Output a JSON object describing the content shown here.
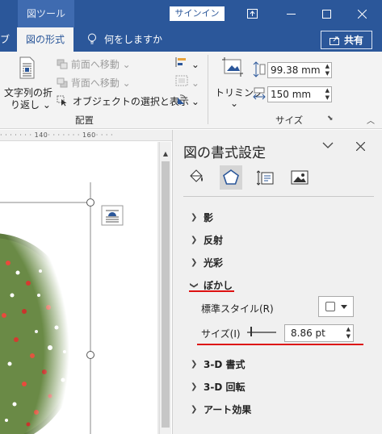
{
  "titlebar": {
    "context_tab": "図ツール",
    "signin": "サインイン"
  },
  "tabs": {
    "prev_fragment": "ブ",
    "active": "図の形式",
    "tellme": "何をしますか",
    "share": "共有"
  },
  "ribbon": {
    "wrap_text": "文字列の折",
    "wrap_text_2": "り返し",
    "bring_forward": "前面へ移動",
    "send_backward": "背面へ移動",
    "selection_pane": "オブジェクトの選択と表示",
    "arrange_group": "配置",
    "crop": "トリミング",
    "height_value": "99.38 mm",
    "width_value": "150 mm",
    "size_group": "サイズ"
  },
  "ruler": {
    "text": "· · · · · · · 140· · · · · · · 160· · · ·"
  },
  "pane": {
    "title": "図の書式設定",
    "sections": {
      "shadow": "影",
      "reflection": "反射",
      "glow": "光彩",
      "soft_edges": "ぼかし",
      "bevel": "3-D 書式",
      "rotation": "3-D 回転",
      "artistic": "アート効果"
    },
    "soft_edges": {
      "preset_label": "標準スタイル(R)",
      "size_label": "サイズ(I)",
      "size_value": "8.86 pt"
    }
  },
  "colors": {
    "accent": "#2b579a",
    "pane_bg": "#f0f0f0",
    "highlight": "#dd1111"
  }
}
